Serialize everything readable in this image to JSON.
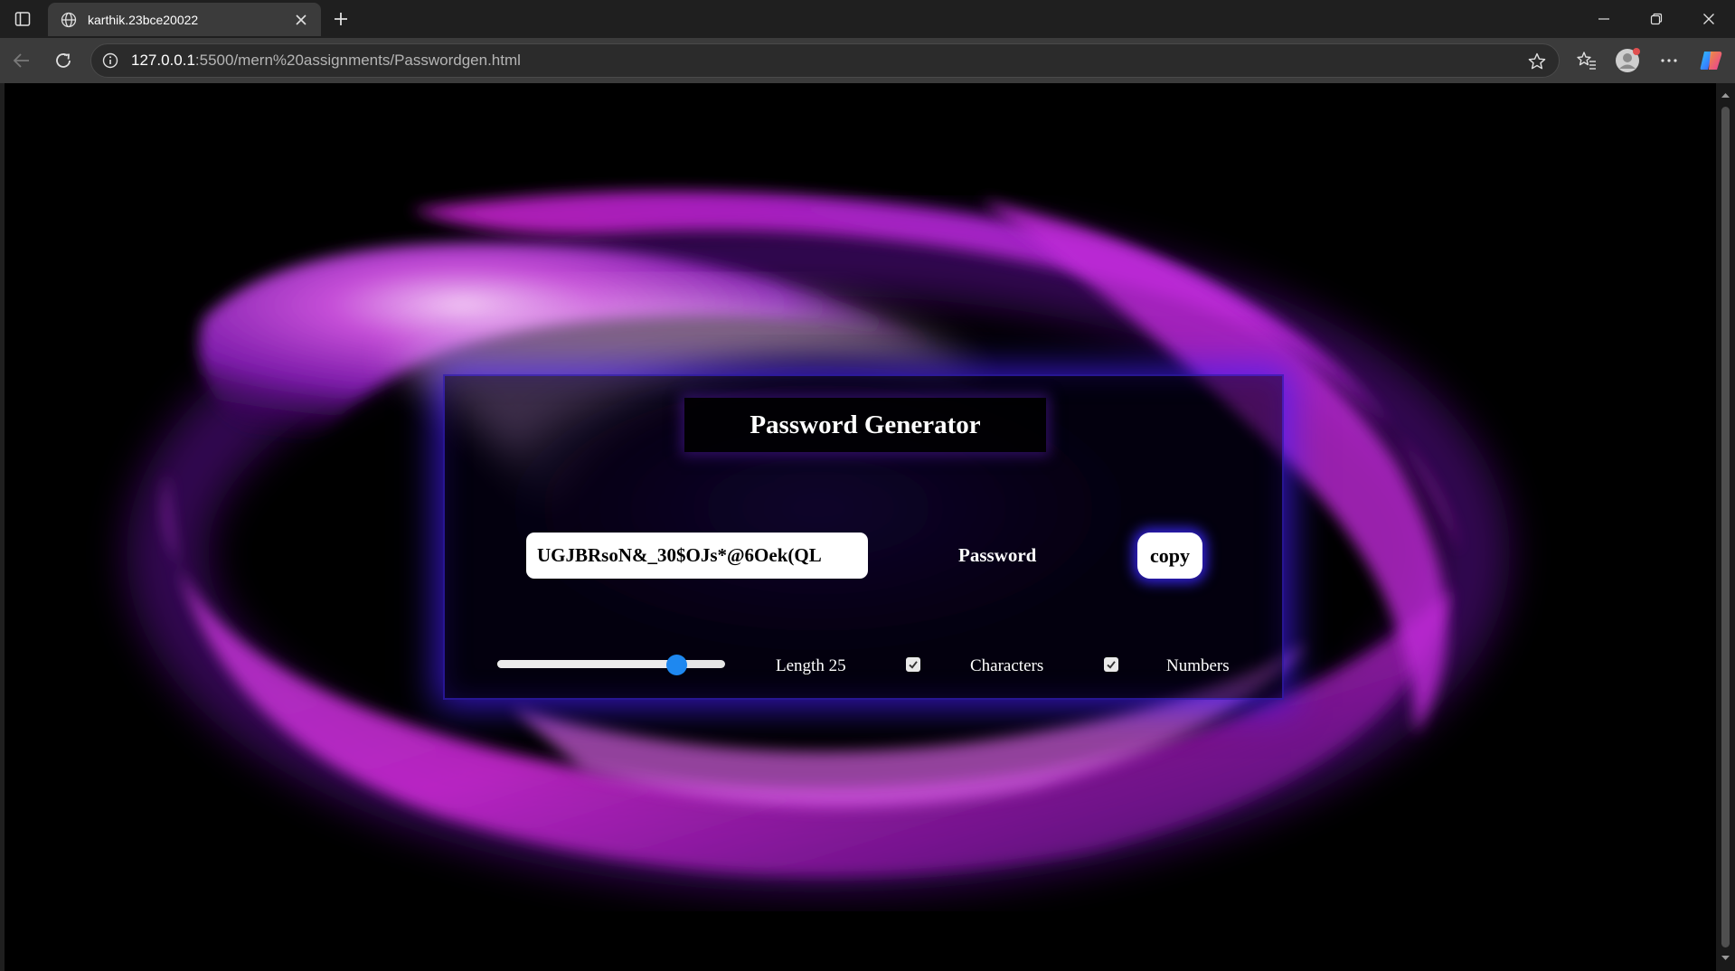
{
  "browser": {
    "tab_title": "karthik.23bce20022",
    "url_host": "127.0.0.1",
    "url_rest": ":5500/mern%20assignments/Passwordgen.html"
  },
  "app": {
    "title": "Password Generator",
    "password_value": "UGJBRsoN&_30$OJs*@6Oek(QL",
    "password_label": "Password",
    "copy_label": "copy",
    "length_label": "Length 25",
    "length_value": 25,
    "length_slider_fraction": 0.79,
    "characters_label": "Characters",
    "characters_checked": true,
    "numbers_label": "Numbers",
    "numbers_checked": true,
    "accent_color": "#1e88f0",
    "glow_color": "#4628ff"
  },
  "icons": {
    "sidebar": "sidebar-toggle-icon",
    "globe": "globe-icon",
    "close_tab": "close-icon",
    "new_tab": "plus-icon",
    "minimize": "minimize-icon",
    "restore": "restore-icon",
    "close_window": "close-icon",
    "back": "back-arrow-icon",
    "reload": "reload-icon",
    "info": "info-icon",
    "favorite": "star-icon",
    "favorites": "favorites-icon",
    "profile": "profile-icon",
    "more": "more-icon",
    "copilot": "copilot-icon"
  }
}
